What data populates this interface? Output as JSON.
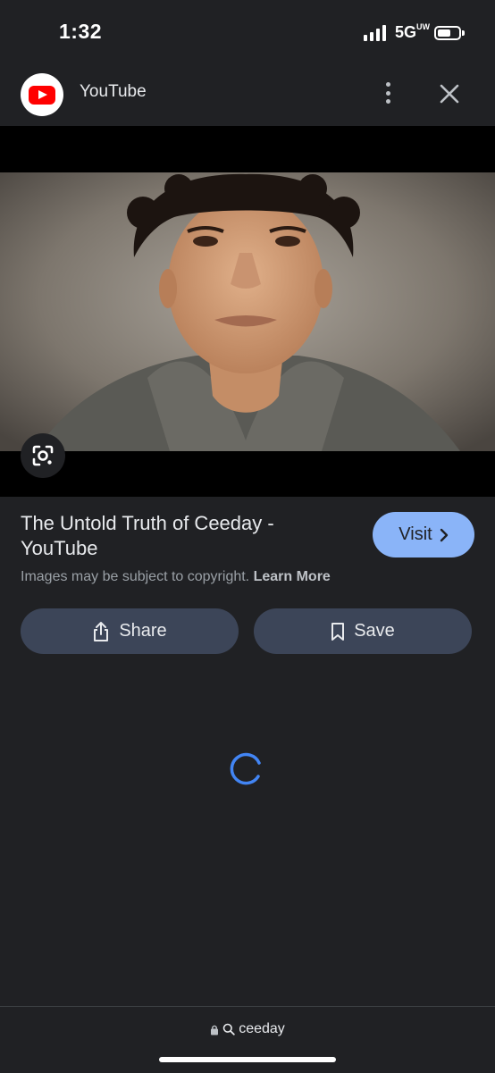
{
  "status_bar": {
    "time": "1:32",
    "network": "5G",
    "network_suffix": "UW",
    "signal_bars": 4,
    "battery_level": 0.55
  },
  "header": {
    "source_name": "YouTube",
    "source_icon": "youtube-logo-icon",
    "more_icon": "more-vert-icon",
    "close_icon": "close-icon"
  },
  "image": {
    "lens_icon": "google-lens-icon"
  },
  "result": {
    "title": "The Untold Truth of Ceeday - YouTube",
    "visit_label": "Visit",
    "copyright_text": "Images may be subject to copyright.",
    "learn_more": "Learn More"
  },
  "actions": {
    "share_label": "Share",
    "save_label": "Save"
  },
  "bottom_bar": {
    "url_text": "ceeday",
    "lock_icon": "lock-icon",
    "search_icon": "search-icon"
  },
  "colors": {
    "background": "#202124",
    "visit_button": "#8ab4f8",
    "action_button": "#3c4558",
    "spinner": "#4285f4",
    "youtube_red": "#ff0000"
  }
}
